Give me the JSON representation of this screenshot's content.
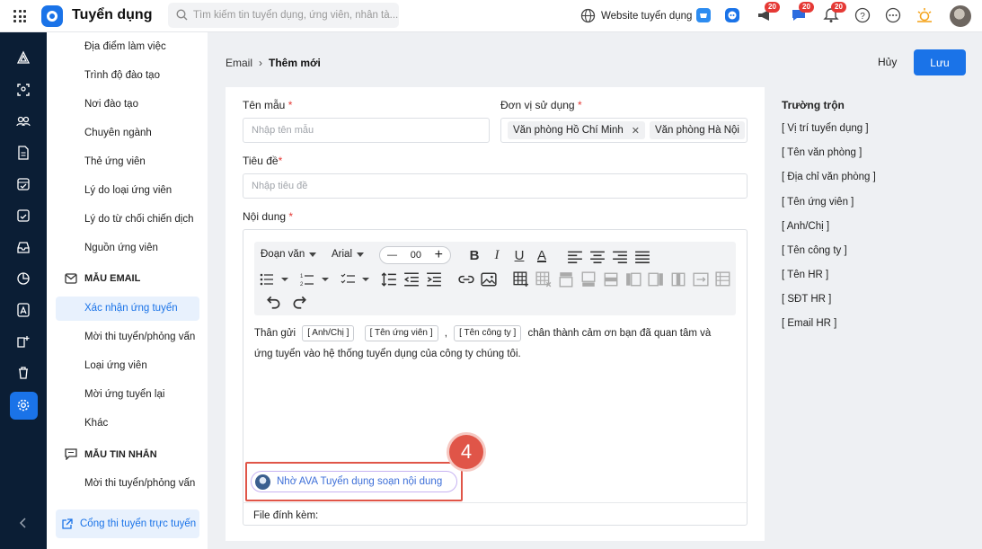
{
  "app": {
    "title": "Tuyển dụng",
    "logo": "q-logo-icon"
  },
  "search": {
    "placeholder": "Tìm kiếm tin tuyển dụng, ứng viên, nhân tà..."
  },
  "header": {
    "website_label": "Website tuyển dụng",
    "badges": {
      "megaphone": "20",
      "chat": "20",
      "bell": "20"
    }
  },
  "rail": {
    "icons": [
      "triangle-logo-icon",
      "scan-icon",
      "team-icon",
      "document-icon",
      "folder-check-icon",
      "calendar-check-icon",
      "inbox-icon",
      "pie-chart-icon",
      "report-icon",
      "user-plus-icon",
      "trash-icon",
      "settings-icon"
    ],
    "active": "settings-icon"
  },
  "sidenav": {
    "items_top": [
      "Địa điểm làm việc",
      "Trình độ đào tạo",
      "Nơi đào tạo",
      "Chuyên ngành",
      "Thẻ ứng viên",
      "Lý do loại ứng viên",
      "Lý do từ chối chiến dịch",
      "Nguồn ứng viên"
    ],
    "email_header": "MẪU EMAIL",
    "email_items": [
      "Xác nhận ứng tuyển",
      "Mời thi tuyển/phỏng vấn",
      "Loại ứng viên",
      "Mời ứng tuyển lại",
      "Khác"
    ],
    "sms_header": "MẪU TIN NHẮN",
    "sms_items": [
      "Mời thi tuyển/phỏng vấn"
    ],
    "footer_link": "Cổng thi tuyển trực tuyến"
  },
  "breadcrumb": {
    "parent": "Email",
    "current": "Thêm mới"
  },
  "actions": {
    "cancel": "Hủy",
    "save": "Lưu"
  },
  "form": {
    "template_name_label": "Tên mẫu",
    "template_name_placeholder": "Nhập tên mẫu",
    "unit_label": "Đơn vị sử dụng",
    "unit_chips": [
      "Văn phòng Hồ Chí Minh",
      "Văn phòng Hà Nội"
    ],
    "subject_label": "Tiêu đề",
    "subject_placeholder": "Nhập tiêu đề",
    "content_label": "Nội dung",
    "required_mark": "*"
  },
  "editor": {
    "paragraph_style": "Đoạn văn",
    "font": "Arial",
    "font_size": "00",
    "body": {
      "greeting": "Thân gửi",
      "tags": [
        "[ Anh/Chị ]",
        "[ Tên ứng viên ]",
        "[ Tên công ty ]"
      ],
      "comma": ",",
      "line1_rest": "chân thành cảm ơn bạn đã quan tâm và",
      "line2": "ứng tuyển vào hệ thống tuyển dụng của công ty chúng tôi."
    },
    "ava_button": "Nhờ AVA Tuyển dụng soạn nội dung",
    "attachments_label": "File đính kèm:",
    "step_number": "4"
  },
  "merge_fields": {
    "title": "Trường trộn",
    "items": [
      "[ Vị trí tuyển dụng ]",
      "[ Tên văn phòng ]",
      "[ Địa chỉ văn phòng ]",
      "[ Tên ứng viên ]",
      "[ Anh/Chị ]",
      "[ Tên công ty ]",
      "[ Tên HR ]",
      "[ SĐT HR ]",
      "[ Email HR ]"
    ]
  },
  "colors": {
    "primary": "#1a73e8",
    "rail": "#0b1e35",
    "badge": "#e53935",
    "highlight": "#e05548"
  }
}
